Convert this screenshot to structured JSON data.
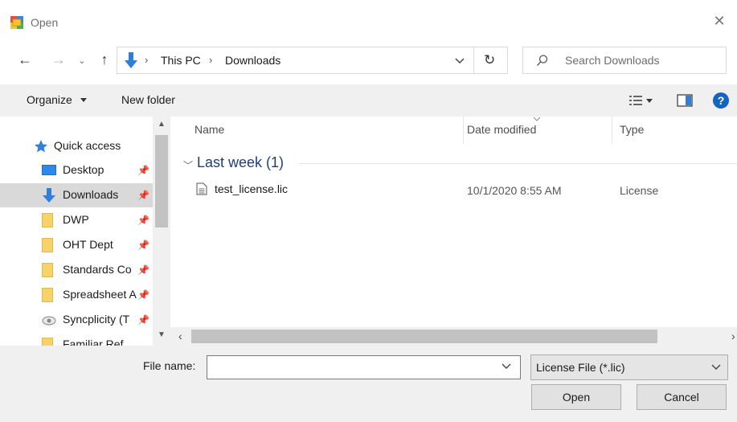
{
  "window": {
    "title": "Open",
    "app_icon": "dialog-app-icon",
    "close_label": "✕"
  },
  "nav": {
    "back": "←",
    "forward": "→",
    "recent": "⌄",
    "up": "↑",
    "breadcrumb": [
      "This PC",
      "Downloads"
    ],
    "breadcrumb_sep": "›",
    "refresh": "↻",
    "search_placeholder": "Search Downloads"
  },
  "toolbar": {
    "organize": "Organize",
    "new_folder": "New folder",
    "help": "?"
  },
  "navpane": {
    "quick_access": "Quick access",
    "items": [
      {
        "label": "Desktop",
        "icon": "desktop-icon",
        "pinned": true,
        "selected": false
      },
      {
        "label": "Downloads",
        "icon": "downloads-icon",
        "pinned": true,
        "selected": true
      },
      {
        "label": "DWP",
        "icon": "folder-icon",
        "pinned": true,
        "selected": false
      },
      {
        "label": "OHT Dept",
        "icon": "folder-icon",
        "pinned": true,
        "selected": false
      },
      {
        "label": "Standards Co",
        "icon": "folder-icon",
        "pinned": true,
        "selected": false
      },
      {
        "label": "Spreadsheet A",
        "icon": "folder-icon",
        "pinned": true,
        "selected": false
      },
      {
        "label": "Syncplicity (T",
        "icon": "syncplicity-icon",
        "pinned": true,
        "selected": false
      },
      {
        "label": "Familiar Ref",
        "icon": "folder-icon",
        "pinned": false,
        "selected": false
      }
    ],
    "pin_glyph": "📌"
  },
  "filelist": {
    "columns": {
      "name": "Name",
      "date": "Date modified",
      "type": "Type"
    },
    "group": "Last week (1)",
    "files": [
      {
        "name": "test_license.lic",
        "date": "10/1/2020 8:55 AM",
        "type": "License"
      }
    ]
  },
  "bottom": {
    "file_name_label": "File name:",
    "file_name_value": "",
    "filter": "License File (*.lic)",
    "open": "Open",
    "cancel": "Cancel"
  },
  "colors": {
    "accent": "#1565c0",
    "selection": "#d9d9d9",
    "chrome": "#f0f0f0",
    "group_heading": "#1e3f73"
  }
}
